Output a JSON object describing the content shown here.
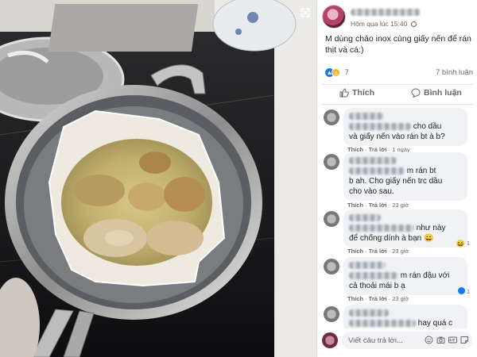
{
  "post": {
    "time": "Hôm qua lúc 15:40",
    "caption": "M dùng chảo inox cùng giấy nến để rán thịt và cá:)",
    "reaction_count": "7",
    "comment_count": "7 bình luận",
    "like_label": "Thích",
    "comment_label": "Bình luận"
  },
  "comments": [
    {
      "lines": [
        "cho dầu",
        "và giấy nến vào rán bt à b?"
      ],
      "like": "Thích",
      "reply": "Trả lời",
      "age": "1 ngày",
      "reaction_count": ""
    },
    {
      "lines": [
        "m rán bt",
        "b ah. Cho giấy nến trc dầu",
        "cho vào sau."
      ],
      "like": "Thích",
      "reply": "Trả lời",
      "age": "23 giờ",
      "reaction_count": ""
    },
    {
      "lines": [
        "như này",
        "để chống dính à bạn 😄"
      ],
      "like": "Thích",
      "reply": "Trả lời",
      "age": "23 giờ",
      "reaction_count": "1"
    },
    {
      "lines": [
        "m rán đậu với",
        "cả thoải mái b ạ"
      ],
      "like": "Thích",
      "reply": "Trả lời",
      "age": "23 giờ",
      "reaction_count": "1"
    },
    {
      "lines": [
        "hay quá c"
      ],
      "like": "",
      "reply": "",
      "age": "",
      "reaction_count": ""
    }
  ],
  "reply_box": {
    "placeholder": "Viết câu trả lời..."
  },
  "icons": {
    "expand": "fullscreen-icon",
    "like": "thumbs-up-icon",
    "comment": "speech-bubble-icon",
    "reply_tools": [
      "emoji-icon",
      "camera-icon",
      "gif-icon",
      "sticker-icon"
    ]
  },
  "colors": {
    "brand": "#1877f2",
    "bubble": "#f0f2f5",
    "muted_text": "#65676b",
    "viewer_bg": "#141414"
  }
}
